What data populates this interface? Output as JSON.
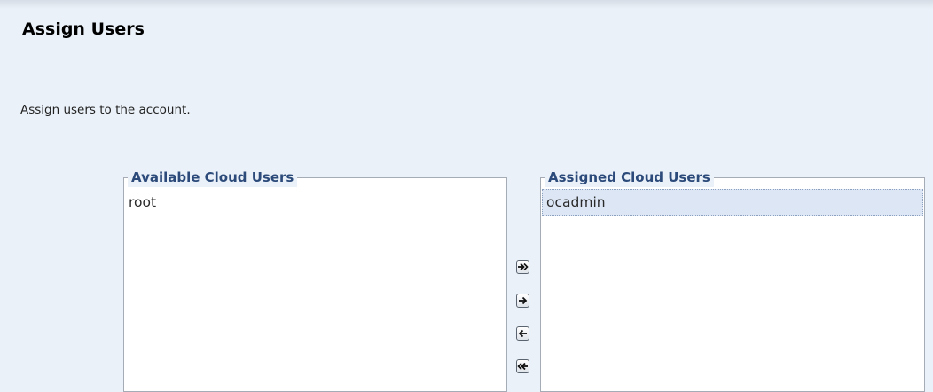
{
  "page": {
    "title": "Assign Users",
    "instruction": "Assign users to the account."
  },
  "available": {
    "caption": "Available Cloud Users",
    "items": [
      "root"
    ]
  },
  "assigned": {
    "caption": "Assigned Cloud Users",
    "items": [
      "ocadmin"
    ],
    "selected_index": 0
  },
  "buttons": {
    "move_all": {
      "icon": "double-arrow-right-icon"
    },
    "move": {
      "icon": "arrow-right-icon"
    },
    "remove": {
      "icon": "arrow-left-icon"
    },
    "remove_all": {
      "icon": "double-arrow-left-icon"
    }
  },
  "colors": {
    "background": "#eaf1f8",
    "caption": "#2c4a7a",
    "selected_row": "#dde6f4"
  }
}
